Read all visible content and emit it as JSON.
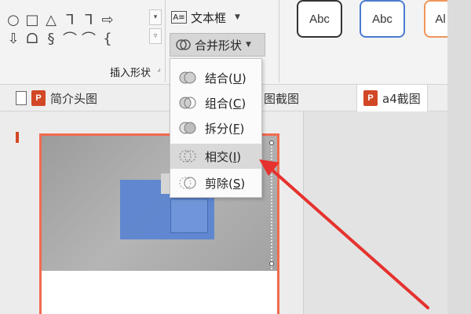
{
  "ribbon": {
    "shape_rows": [
      [
        "○",
        "□",
        "△",
        "ᒣ",
        "ᒣ",
        "⇨"
      ],
      [
        "⇩",
        "ᗝ",
        "§",
        "⌒",
        "⌒",
        "{"
      ]
    ],
    "group_label": "插入形状",
    "textbox_label": "文本框",
    "merge_shapes_label": "合并形状",
    "style_samples": [
      "Abc",
      "Abc",
      "Al"
    ]
  },
  "merge_menu": {
    "items": [
      {
        "label": "结合(",
        "key": "U",
        "suffix": ")"
      },
      {
        "label": "组合(",
        "key": "C",
        "suffix": ")"
      },
      {
        "label": "拆分(",
        "key": "F",
        "suffix": ")"
      },
      {
        "label": "相交(",
        "key": "I",
        "suffix": ")"
      },
      {
        "label": "剪除(",
        "key": "S",
        "suffix": ")"
      }
    ],
    "highlighted_index": 3
  },
  "tabs": [
    {
      "label": "简介头图"
    },
    {
      "label": "图截图"
    },
    {
      "label": "a4截图"
    }
  ],
  "colors": {
    "accent": "#f26a4f",
    "arrow": "#e5322e",
    "highlight": "#d9d9d9"
  }
}
